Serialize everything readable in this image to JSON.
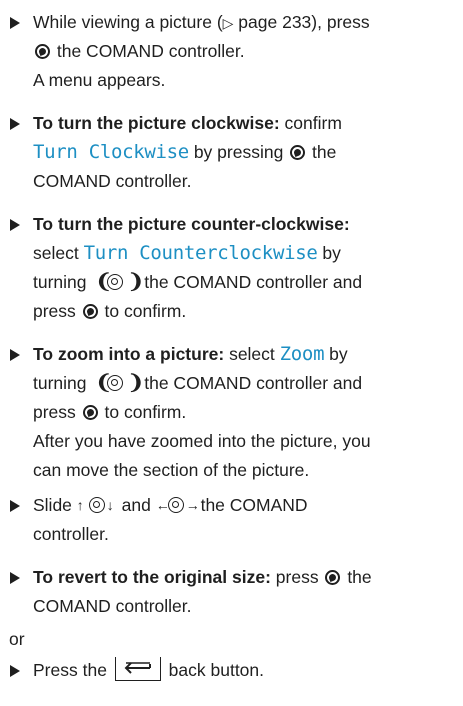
{
  "steps": [
    {
      "l1a": "While viewing a picture (",
      "l1sym": "▷",
      "l1b": " page 233), press",
      "l2b": " the COMAND controller.",
      "l3": "A menu appears."
    },
    {
      "bold": "To turn the picture clockwise:",
      "rest": " confirm",
      "menu": "Turn Clockwise",
      "l2b": " by pressing ",
      "l2c": " the",
      "l3": "COMAND controller."
    },
    {
      "bold": "To turn the picture counter-clockwise:",
      "l2a": "select ",
      "menu": "Turn Counterclockwise",
      "l2b": " by",
      "l3a": "turning ",
      "l3b": " the COMAND controller and",
      "l4a": "press ",
      "l4b": " to confirm."
    },
    {
      "bold": "To zoom into a picture:",
      "l1b": " select ",
      "menu": "Zoom",
      "l1c": " by",
      "l2a": "turning ",
      "l2b": " the COMAND controller and",
      "l3a": "press ",
      "l3b": " to confirm.",
      "l4": "After you have zoomed into the picture, you",
      "l5": "can move the section of the picture."
    },
    {
      "l1a": "Slide ",
      "l1b": " and ",
      "l1c": " the COMAND",
      "l2": "controller."
    },
    {
      "bold": "To revert to the original size:",
      "l1b": " press ",
      "l1c": " the",
      "l2": "COMAND controller."
    }
  ],
  "or_text": "or",
  "last": {
    "a": "Press the ",
    "b": " back button."
  },
  "icons": {
    "press": "press-controller-icon",
    "turn": "turn-controller-icon",
    "slide_vertical": "slide-vertical-icon",
    "slide_horizontal": "slide-horizontal-icon",
    "back": "back-button-icon"
  }
}
